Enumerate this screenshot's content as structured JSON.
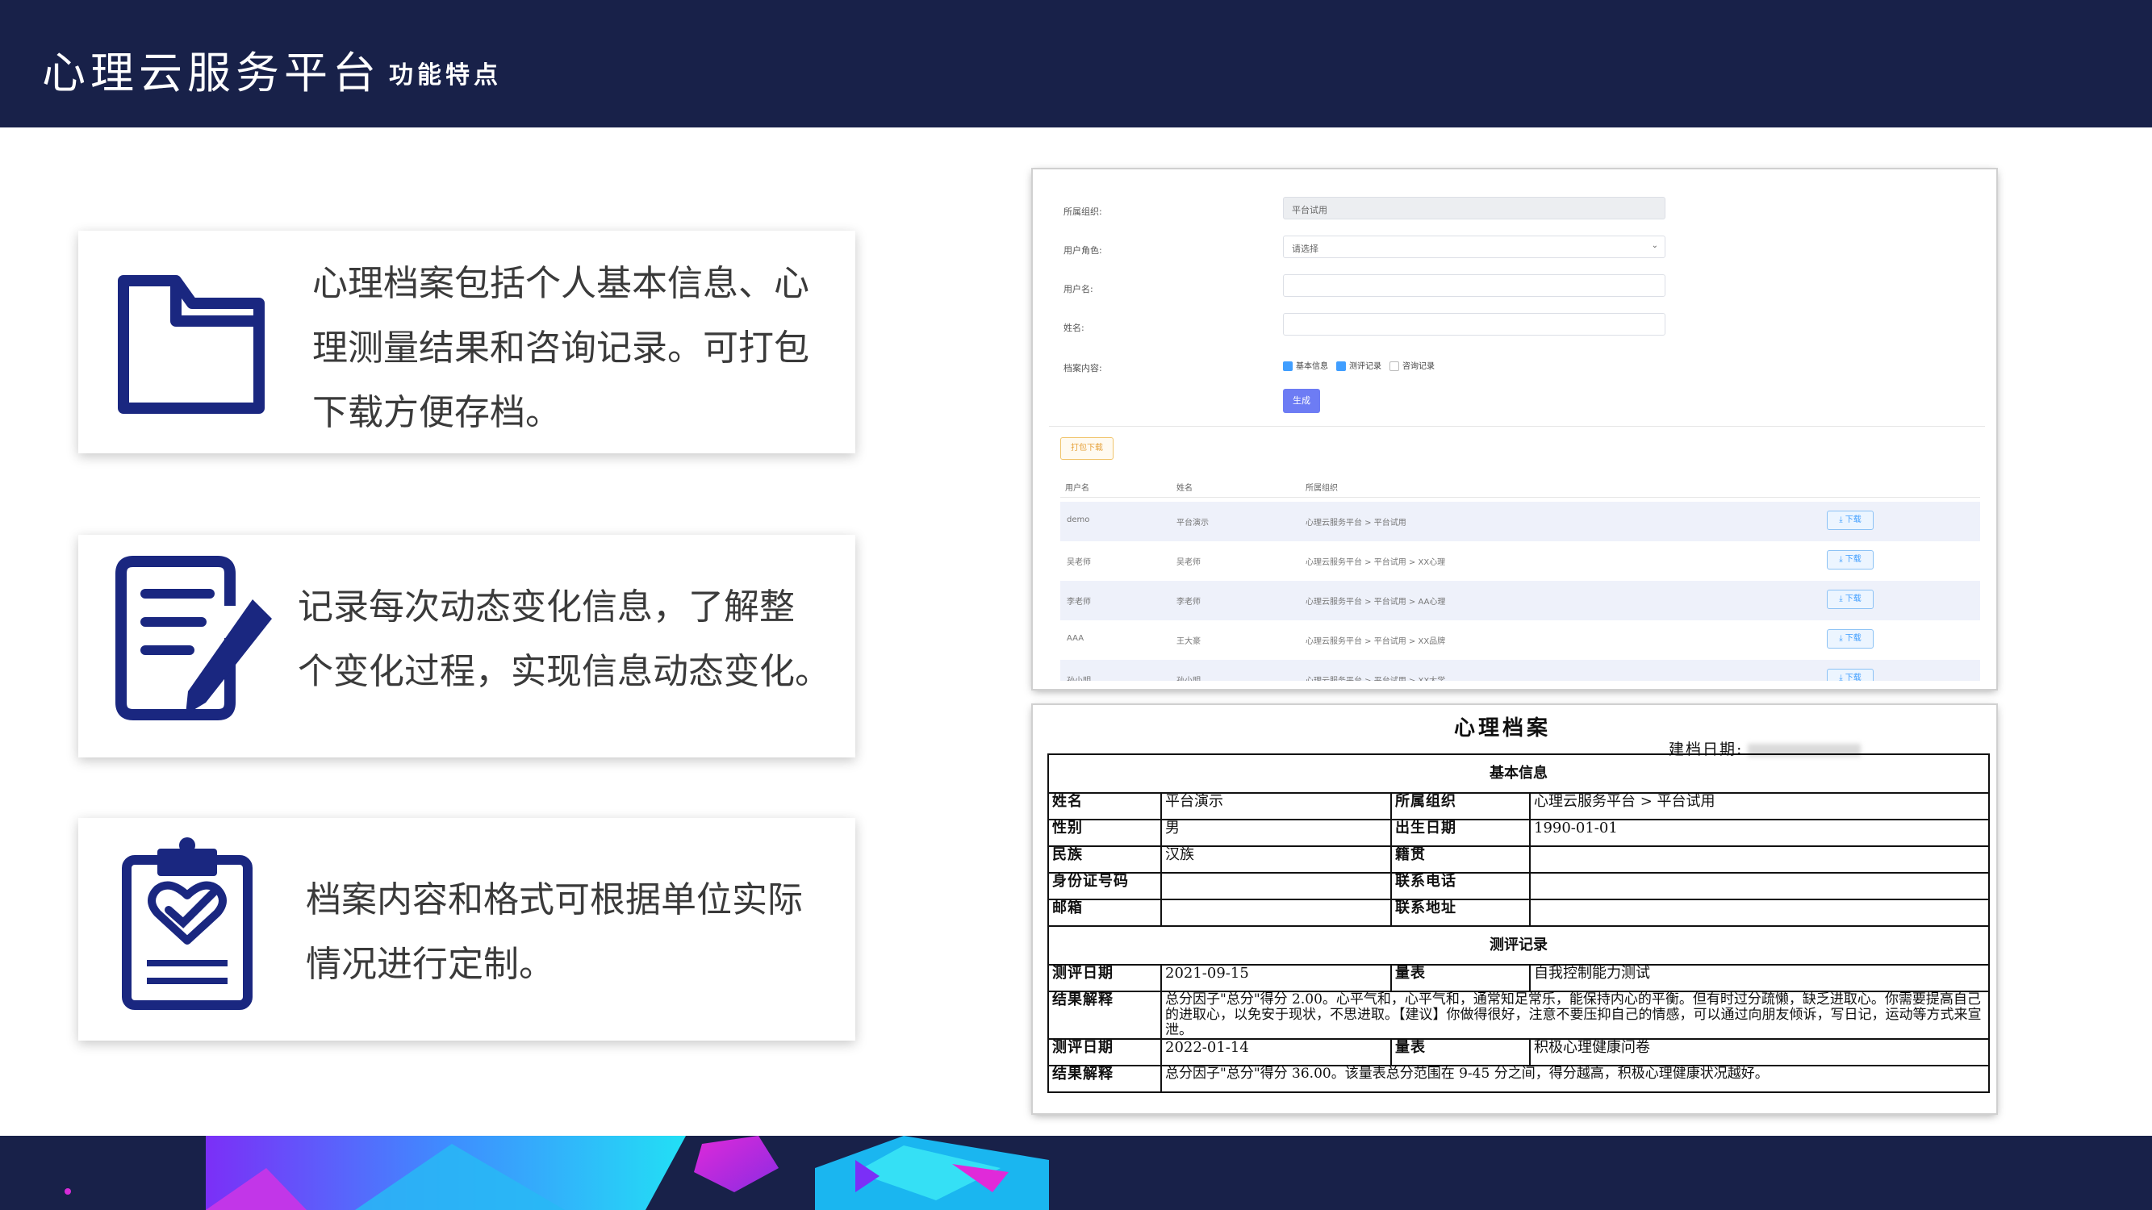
{
  "header": {
    "title": "心理云服务平台",
    "subtitle": "功能特点"
  },
  "features": [
    {
      "icon": "folder-icon",
      "lines": [
        "心理档案包括个人基本信息、心",
        "理测量结果和咨询记录。可打包",
        "下载方便存档。"
      ]
    },
    {
      "icon": "document-edit-icon",
      "lines": [
        "记录每次动态变化信息，了解整",
        "个变化过程，实现信息动态变化。"
      ]
    },
    {
      "icon": "clipboard-heart-icon",
      "lines": [
        "档案内容和格式可根据单位实际",
        "情况进行定制。"
      ]
    }
  ],
  "form_screenshot": {
    "fields": [
      {
        "label": "所属组织:",
        "value": "平台试用",
        "disabled": true
      },
      {
        "label": "用户角色:",
        "value": "请选择",
        "select": true
      },
      {
        "label": "用户名:",
        "value": ""
      },
      {
        "label": "姓名:",
        "value": ""
      }
    ],
    "content_label": "档案内容:",
    "checkboxes": [
      {
        "label": "基本信息",
        "checked": true
      },
      {
        "label": "测评记录",
        "checked": true
      },
      {
        "label": "咨询记录",
        "checked": false
      }
    ],
    "generate_label": "生成",
    "download_all_label": "打包下载",
    "columns": [
      "用户名",
      "姓名",
      "所属组织"
    ],
    "rows": [
      {
        "username": "demo",
        "name": "平台演示",
        "org": "心理云服务平台 > 平台试用",
        "action": "⤓ 下载"
      },
      {
        "username": "吴老师",
        "name": "吴老师",
        "org": "心理云服务平台 > 平台试用 > XX心理",
        "action": "⤓ 下载"
      },
      {
        "username": "李老师",
        "name": "李老师",
        "org": "心理云服务平台 > 平台试用 > AA心理",
        "action": "⤓ 下载"
      },
      {
        "username": "AAA",
        "name": "王大豪",
        "org": "心理云服务平台 > 平台试用 > XX品牌",
        "action": "⤓ 下载"
      },
      {
        "username": "孙小明",
        "name": "孙小明",
        "org": "心理云服务平台 > 平台试用 > XX大学",
        "action": "⤓ 下载"
      }
    ]
  },
  "document_screenshot": {
    "title": "心理档案",
    "date_label": "建档日期:",
    "basic_section": "基本信息",
    "basic_rows": [
      [
        "姓名",
        "平台演示",
        "所属组织",
        "心理云服务平台 > 平台试用"
      ],
      [
        "性别",
        "男",
        "出生日期",
        "1990-01-01"
      ],
      [
        "民族",
        "汉族",
        "籍贯",
        ""
      ],
      [
        "身份证号码",
        "",
        "联系电话",
        ""
      ],
      [
        "邮箱",
        "",
        "联系地址",
        ""
      ]
    ],
    "eval_section": "测评记录",
    "records": [
      {
        "date_label": "测评日期",
        "date": "2021-09-15",
        "scale_label": "量表",
        "scale": "自我控制能力测试",
        "result_label": "结果解释",
        "result": "总分因子\"总分\"得分 2.00。心平气和，心平气和，通常知足常乐，能保持内心的平衡。但有时过分疏懒，缺乏进取心。你需要提高自己的进取心，以免安于现状，不思进取。【建议】你做得很好，注意不要压抑自己的情感，可以通过向朋友倾诉，写日记，运动等方式来宣泄。"
      },
      {
        "date_label": "测评日期",
        "date": "2022-01-14",
        "scale_label": "量表",
        "scale": "积极心理健康问卷",
        "result_label": "结果解释",
        "result": "总分因子\"总分\"得分 36.00。该量表总分范围在 9-45 分之间，得分越高，积极心理健康状况越好。"
      }
    ]
  }
}
